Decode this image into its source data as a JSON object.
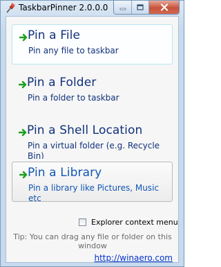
{
  "window": {
    "title": "TaskbarPinner 2.0.0.0"
  },
  "commands": [
    {
      "title": "Pin a File",
      "description": "Pin any file to taskbar"
    },
    {
      "title": "Pin a Folder",
      "description": "Pin a folder to taskbar"
    },
    {
      "title": "Pin a Shell Location",
      "description": "Pin a virtual folder (e.g. Recycle Bin)"
    },
    {
      "title": "Pin a Library",
      "description": "Pin a library like Pictures, Music etc"
    }
  ],
  "options": {
    "explorer_context_menu_label": "Explorer context menu",
    "explorer_context_menu_checked": false
  },
  "footer": {
    "tip": "Tip: You can drag any file or folder on this window",
    "link": "http://winaero.com"
  },
  "colors": {
    "command_text": "#10317a",
    "selected_text": "#1156b3",
    "arrow_green": "#1ea01e",
    "link": "#0033cc"
  },
  "icons": {
    "app": "pushpin-icon",
    "command": "green-arrow-icon"
  }
}
